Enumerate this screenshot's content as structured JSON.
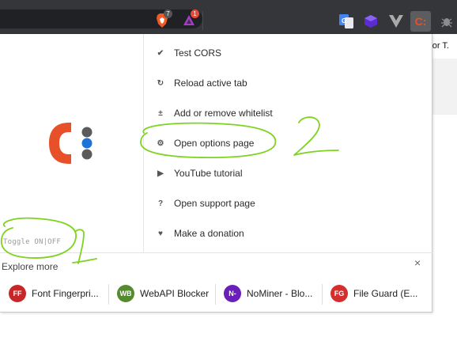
{
  "toolbar": {
    "brave_badge": "7",
    "rewards_badge": "1",
    "ext_cors_label": "C:"
  },
  "page": {
    "snippet": "r or T."
  },
  "popup": {
    "toggle_text": "Toggle ON|OFF",
    "menu": [
      {
        "icon": "check-icon",
        "glyph": "✔",
        "label": "Test CORS"
      },
      {
        "icon": "reload-icon",
        "glyph": "↻",
        "label": "Reload active tab"
      },
      {
        "icon": "plus-minus-icon",
        "glyph": "±",
        "label": "Add or remove whitelist"
      },
      {
        "icon": "gear-icon",
        "glyph": "⚙",
        "label": "Open options page"
      },
      {
        "icon": "play-icon",
        "glyph": "▶",
        "label": "YouTube tutorial"
      },
      {
        "icon": "question-icon",
        "glyph": "?",
        "label": "Open support page"
      },
      {
        "icon": "heart-icon",
        "glyph": "♥",
        "label": "Make a donation"
      }
    ],
    "explore": {
      "label": "Explore more",
      "close": "×",
      "items": [
        {
          "abbr": "FF",
          "name": "Font Fingerpri...",
          "color": "#c62828"
        },
        {
          "abbr": "WB",
          "name": "WebAPI Blocker",
          "color": "#558b2f"
        },
        {
          "abbr": "N-",
          "name": "NoMiner - Blo...",
          "color": "#6a1fb8"
        },
        {
          "abbr": "FG",
          "name": "File Guard (E...",
          "color": "#d32f2f"
        }
      ]
    }
  },
  "annotations": {
    "mark_1": "1",
    "mark_2": "2",
    "color": "#7ed321"
  },
  "colors": {
    "logo_orange": "#e8502a",
    "logo_blue": "#1e73d8",
    "logo_grey": "#5b5b5b"
  }
}
